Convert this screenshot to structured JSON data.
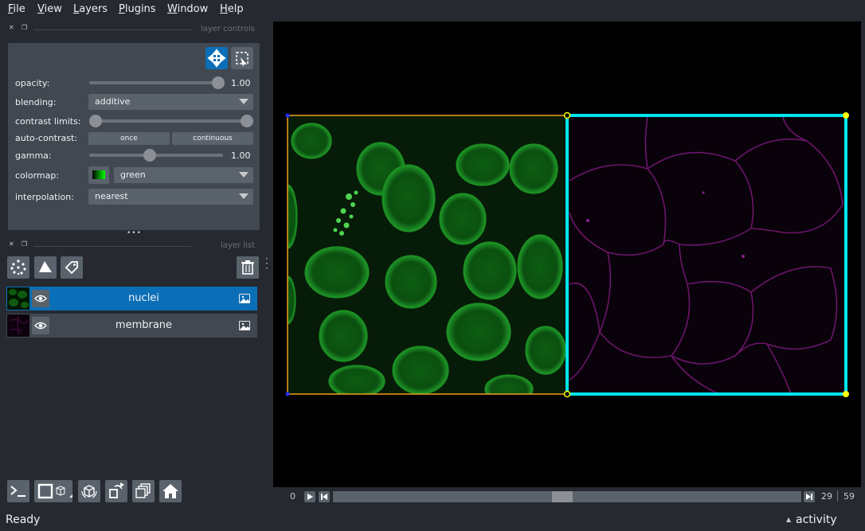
{
  "menubar": {
    "items": [
      {
        "label": "File",
        "mn": "F",
        "rest": "ile"
      },
      {
        "label": "View",
        "mn": "V",
        "rest": "iew"
      },
      {
        "label": "Layers",
        "mn": "L",
        "rest": "ayers"
      },
      {
        "label": "Plugins",
        "mn": "P",
        "rest": "lugins"
      },
      {
        "label": "Window",
        "mn": "W",
        "rest": "indow"
      },
      {
        "label": "Help",
        "mn": "H",
        "rest": "elp"
      }
    ]
  },
  "layer_controls": {
    "title": "layer controls",
    "opacity": {
      "label": "opacity:",
      "value": "1.00",
      "fraction": 1.0
    },
    "blending": {
      "label": "blending:",
      "value": "additive"
    },
    "contrast_limits": {
      "label": "contrast limits:",
      "low_fraction": 0.0,
      "high_fraction": 1.0
    },
    "auto_contrast": {
      "label": "auto-contrast:",
      "once": "once",
      "continuous": "continuous"
    },
    "gamma": {
      "label": "gamma:",
      "value": "1.00",
      "fraction": 0.45
    },
    "colormap": {
      "label": "colormap:",
      "value": "green"
    },
    "interpolation": {
      "label": "interpolation:",
      "value": "nearest"
    }
  },
  "layer_list": {
    "title": "layer list",
    "handle": "•••",
    "layers": [
      {
        "name": "nuclei",
        "selected": true,
        "color": "#0b6fb8"
      },
      {
        "name": "membrane",
        "selected": false,
        "color": "#414851"
      }
    ]
  },
  "dims": {
    "start": "0",
    "current": "29",
    "total": "59",
    "position_fraction": 0.49
  },
  "status": {
    "text": "Ready",
    "activity": "activity",
    "activity_arrow": "▲"
  },
  "colors": {
    "background": "#262930",
    "panel": "#414851",
    "control": "#5a626c",
    "accent": "#0b6fb8",
    "nuclei": "#2f8f2f",
    "membrane": "#8a1f8a",
    "bbox_orange": "#f0a020",
    "bbox_cyan": "#00e5ee"
  }
}
